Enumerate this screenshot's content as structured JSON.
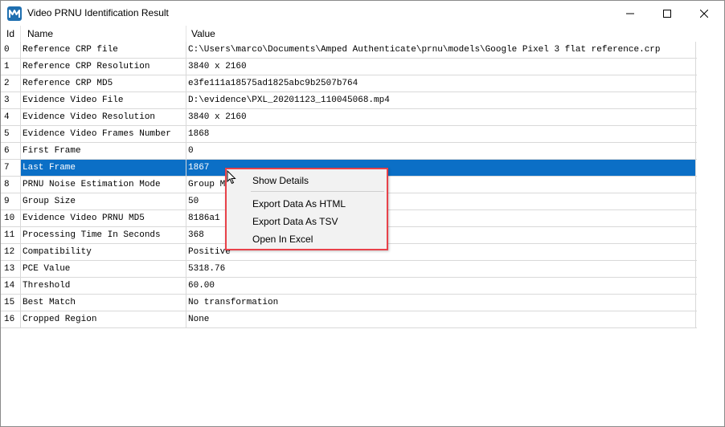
{
  "window": {
    "title": "Video PRNU Identification Result",
    "icon": "amped-app-icon",
    "controls": [
      "minimize-icon",
      "maximize-icon",
      "close-icon"
    ]
  },
  "table": {
    "columns": [
      "Id",
      "Name",
      "Value"
    ],
    "rows": [
      {
        "id": "0",
        "name": "Reference CRP file",
        "value": "C:\\Users\\marco\\Documents\\Amped Authenticate\\prnu\\models\\Google Pixel 3 flat reference.crp"
      },
      {
        "id": "1",
        "name": "Reference CRP Resolution",
        "value": "3840 x 2160"
      },
      {
        "id": "2",
        "name": "Reference CRP MD5",
        "value": "e3fe111a18575ad1825abc9b2507b764"
      },
      {
        "id": "3",
        "name": "Evidence Video File",
        "value": "D:\\evidence\\PXL_20201123_110045068.mp4"
      },
      {
        "id": "4",
        "name": "Evidence Video Resolution",
        "value": "3840 x 2160"
      },
      {
        "id": "5",
        "name": "Evidence Video Frames Number",
        "value": "1868"
      },
      {
        "id": "6",
        "name": "First Frame",
        "value": "0"
      },
      {
        "id": "7",
        "name": "Last Frame",
        "value": "1867"
      },
      {
        "id": "8",
        "name": "PRNU Noise Estimation Mode",
        "value": "Group M"
      },
      {
        "id": "9",
        "name": "Group Size",
        "value": "50"
      },
      {
        "id": "10",
        "name": "Evidence Video PRNU MD5",
        "value": "8186a1"
      },
      {
        "id": "11",
        "name": "Processing Time In Seconds",
        "value": "368"
      },
      {
        "id": "12",
        "name": "Compatibility",
        "value": "Positive"
      },
      {
        "id": "13",
        "name": "PCE Value",
        "value": "5318.76"
      },
      {
        "id": "14",
        "name": "Threshold",
        "value": "60.00"
      },
      {
        "id": "15",
        "name": "Best Match",
        "value": "No transformation"
      },
      {
        "id": "16",
        "name": "Cropped Region",
        "value": "None"
      }
    ],
    "selected_row_id": "7"
  },
  "context_menu": {
    "items": [
      "Show Details",
      "Export Data As HTML",
      "Export Data As TSV",
      "Open In Excel"
    ],
    "highlight_color": "#e8424a"
  },
  "colors": {
    "selection": "#0b6fc6",
    "app_icon": "#1f6fb0"
  }
}
